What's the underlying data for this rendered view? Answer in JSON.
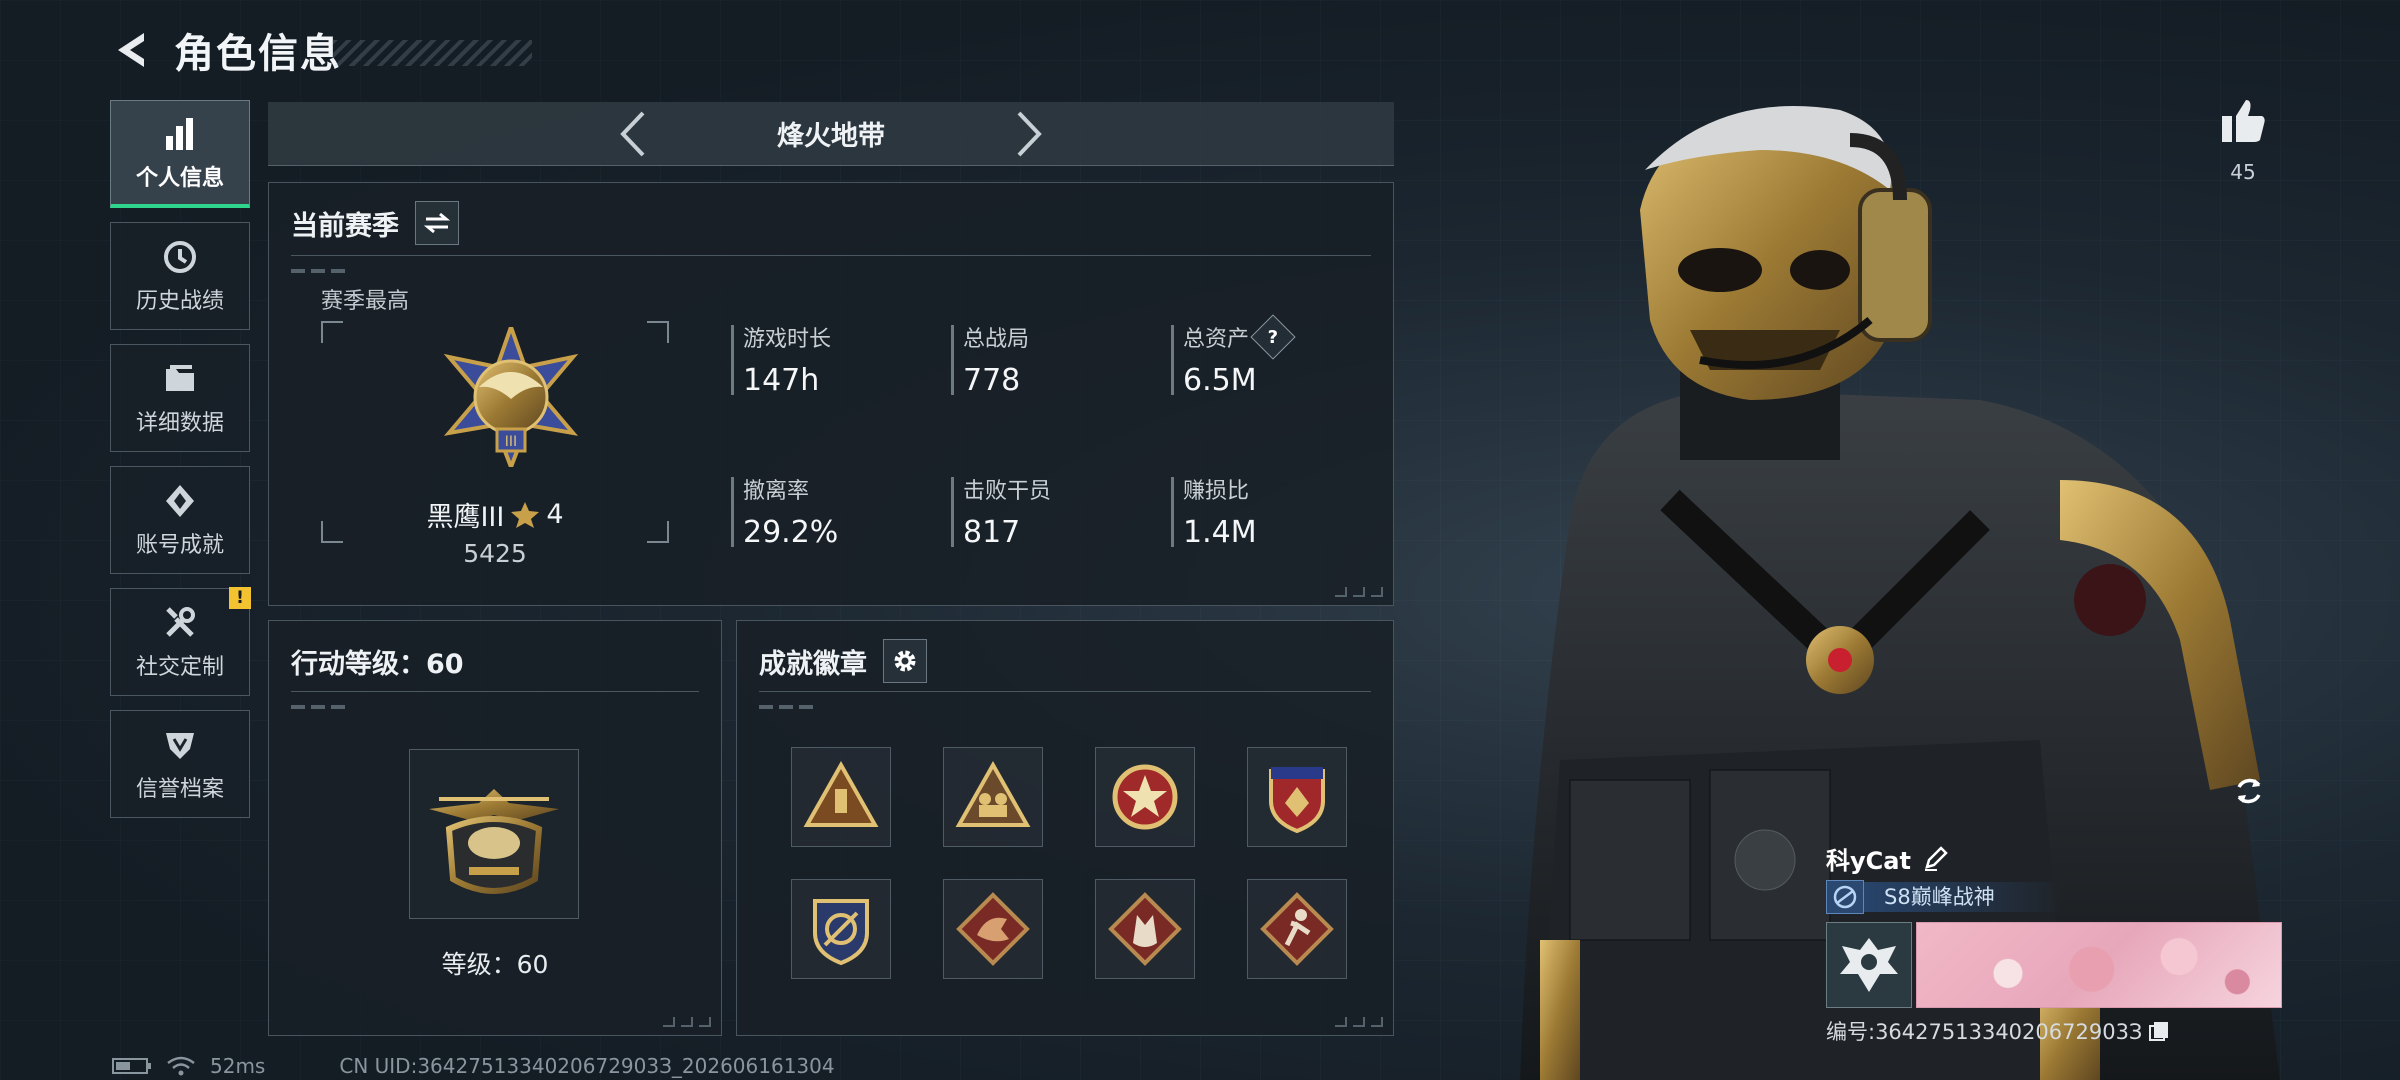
{
  "header": {
    "title": "角色信息"
  },
  "sidebar": {
    "items": [
      {
        "label": "个人信息",
        "active": true
      },
      {
        "label": "历史战绩"
      },
      {
        "label": "详细数据"
      },
      {
        "label": "账号成就"
      },
      {
        "label": "社交定制",
        "badge": "!"
      },
      {
        "label": "信誉档案"
      }
    ]
  },
  "mode": {
    "title": "烽火地带"
  },
  "season": {
    "title": "当前赛季",
    "subtitle": "赛季最高",
    "rank_name": "黑鹰III",
    "rank_stars": "4",
    "rank_score": "5425",
    "stats": [
      {
        "label": "游戏时长",
        "value": "147h"
      },
      {
        "label": "总战局",
        "value": "778"
      },
      {
        "label": "总资产",
        "value": "6.5M",
        "help": "?"
      },
      {
        "label": "撤离率",
        "value": "29.2%"
      },
      {
        "label": "击败干员",
        "value": "817"
      },
      {
        "label": "赚损比",
        "value": "1.4M"
      }
    ]
  },
  "action_level": {
    "title": "行动等级：60",
    "level_text": "等级：60"
  },
  "badges": {
    "title": "成就徽章"
  },
  "likes": {
    "count": "45"
  },
  "player": {
    "name": "科yCat",
    "title": "S8巅峰战神",
    "id_text": "编号:3642751334020672903З"
  },
  "status": {
    "ping": "52ms",
    "uid": "CN UID:3642751334020672903З_202606161304"
  },
  "colors": {
    "accent": "#2fd58d",
    "warning": "#f2c230",
    "gold": "#c9a04a"
  }
}
